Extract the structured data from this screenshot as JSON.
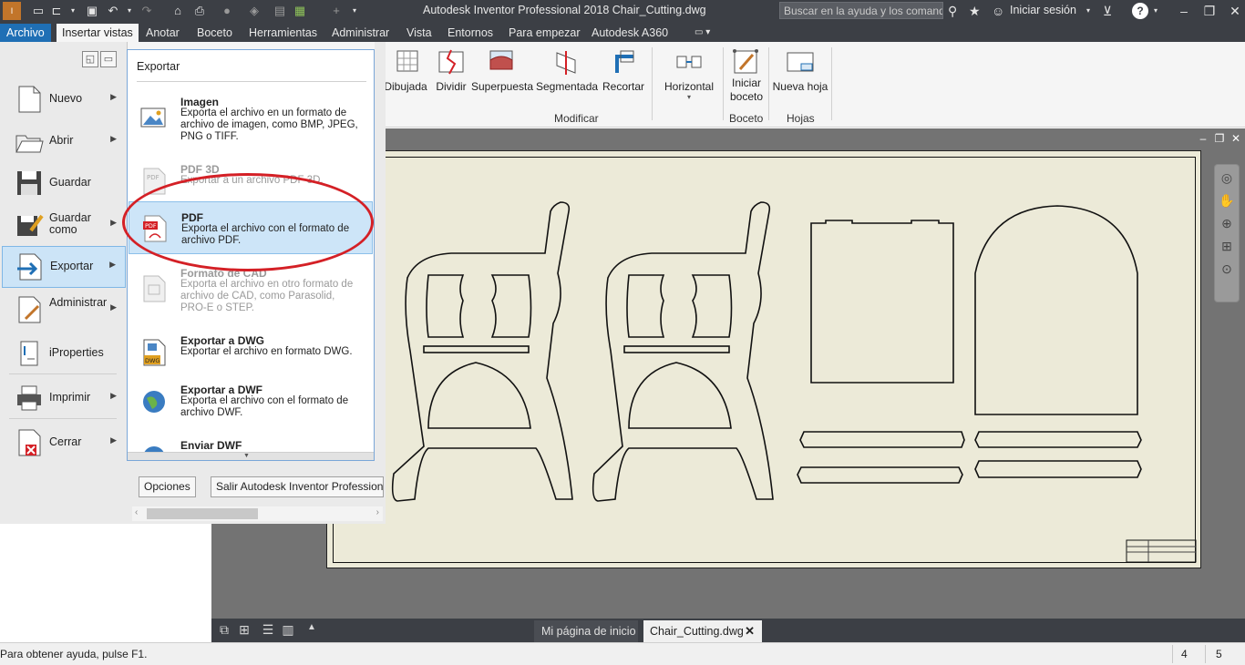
{
  "titlebar": {
    "app_title": "Autodesk Inventor Professional 2018   Chair_Cutting.dwg",
    "search_placeholder": "Buscar en la ayuda y los comandos",
    "signin_label": "Iniciar sesión"
  },
  "tabs": [
    "Archivo",
    "Insertar vistas",
    "Anotar",
    "Boceto",
    "Herramientas",
    "Administrar",
    "Vista",
    "Entornos",
    "Para empezar",
    "Autodesk A360"
  ],
  "ribbon": {
    "buttons": [
      "Dibujada",
      "Dividir",
      "Superpuesta",
      "Segmentada",
      "Recortar",
      "Horizontal",
      "Iniciar boceto",
      "Nueva hoja"
    ],
    "groups": [
      "Modificar",
      "Boceto",
      "Hojas"
    ]
  },
  "app_menu": {
    "items": [
      {
        "label": "Nuevo",
        "icon": "new-file-icon"
      },
      {
        "label": "Abrir",
        "icon": "open-folder-icon"
      },
      {
        "label": "Guardar",
        "icon": "save-icon"
      },
      {
        "label": "Guardar como",
        "icon": "save-as-icon"
      },
      {
        "label": "Exportar",
        "icon": "export-icon"
      },
      {
        "label": "Administrar",
        "icon": "manage-icon"
      },
      {
        "label": "iProperties",
        "icon": "iproperties-icon"
      },
      {
        "label": "Imprimir",
        "icon": "print-icon"
      },
      {
        "label": "Cerrar",
        "icon": "close-file-icon"
      }
    ],
    "submenu_title": "Exportar",
    "submenu": [
      {
        "title": "Imagen",
        "desc": "Exporta el archivo en un formato de archivo de imagen, como BMP, JPEG, PNG o TIFF."
      },
      {
        "title": "PDF 3D",
        "desc": "Exportar a un archivo PDF 3D."
      },
      {
        "title": "PDF",
        "desc": "Exporta el archivo con el formato de archivo PDF."
      },
      {
        "title": "Formato de CAD",
        "desc": "Exporta el archivo en otro formato de archivo de CAD, como Parasolid, PRO-E o STEP."
      },
      {
        "title": "Exportar a DWG",
        "desc": "Exportar el archivo en formato DWG."
      },
      {
        "title": "Exportar a DWF",
        "desc": "Exporta el archivo con el formato de archivo DWF."
      },
      {
        "title": "Enviar DWF",
        "desc": ""
      }
    ],
    "options_button": "Opciones",
    "exit_button": "Salir Autodesk Inventor Professional"
  },
  "doc_tabs": {
    "home": "Mi página de inicio",
    "active": "Chair_Cutting.dwg"
  },
  "status": {
    "help_text": "Para obtener ayuda, pulse F1.",
    "num1": "4",
    "num2": "5"
  },
  "colors": {
    "accent": "#1f6fb5",
    "highlight_ellipse": "#d42026",
    "sheet": "#ecead8"
  }
}
